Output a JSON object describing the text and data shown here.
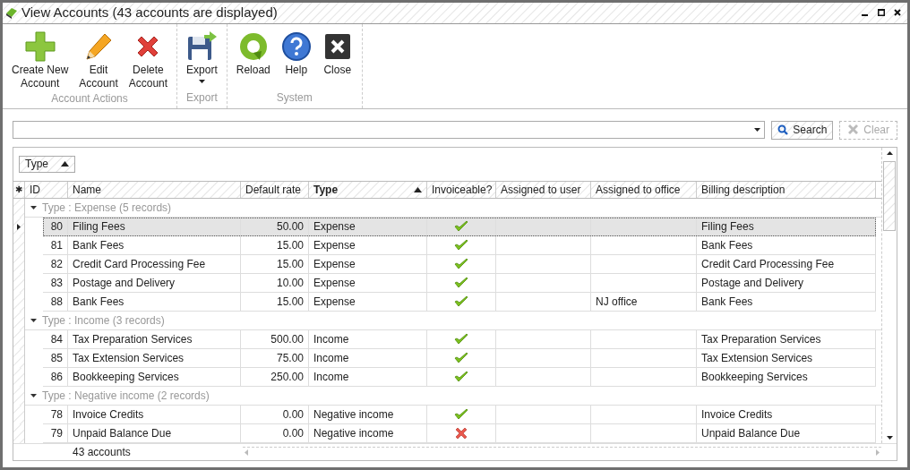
{
  "window": {
    "title": "View Accounts (43 accounts are displayed)"
  },
  "toolbar": {
    "groups": [
      {
        "label": "Account Actions",
        "buttons": [
          {
            "kind": "add",
            "lines": [
              "Create New",
              "Account"
            ]
          },
          {
            "kind": "edit",
            "lines": [
              "Edit",
              "Account"
            ]
          },
          {
            "kind": "delete",
            "lines": [
              "Delete",
              "Account"
            ]
          }
        ]
      },
      {
        "label": "Export",
        "buttons": [
          {
            "kind": "export",
            "lines": [
              "Export"
            ],
            "dropdown": true
          }
        ]
      },
      {
        "label": "System",
        "buttons": [
          {
            "kind": "reload",
            "lines": [
              "Reload"
            ]
          },
          {
            "kind": "help",
            "lines": [
              "Help"
            ]
          },
          {
            "kind": "close",
            "lines": [
              "Close"
            ]
          }
        ]
      }
    ]
  },
  "search": {
    "search_button": "Search",
    "clear_button": {
      "label": "Clear",
      "disabled": true
    }
  },
  "grid": {
    "group_by": "Type",
    "corner": "✱",
    "columns": [
      {
        "label": "ID",
        "sorted": false
      },
      {
        "label": "Name",
        "sorted": false
      },
      {
        "label": "Default rate",
        "sorted": false
      },
      {
        "label": "Type",
        "sorted": true
      },
      {
        "label": "Invoiceable?",
        "sorted": false
      },
      {
        "label": "Assigned to user",
        "sorted": false
      },
      {
        "label": "Assigned to office",
        "sorted": false
      },
      {
        "label": "Billing description",
        "sorted": false
      }
    ],
    "groups": [
      {
        "label": "Type : Expense (5 records)",
        "expanded": true,
        "rows": [
          {
            "id": "80",
            "name": "Filing Fees",
            "rate": "50.00",
            "type": "Expense",
            "invoiceable": true,
            "billing": "Filing Fees",
            "selected": true
          },
          {
            "id": "81",
            "name": "Bank Fees",
            "rate": "15.00",
            "type": "Expense",
            "invoiceable": true,
            "billing": "Bank Fees",
            "selected": false
          },
          {
            "id": "82",
            "name": "Credit Card Processing Fee",
            "rate": "15.00",
            "type": "Expense",
            "invoiceable": true,
            "billing": "Credit Card Processing Fee",
            "selected": false
          },
          {
            "id": "83",
            "name": "Postage and Delivery",
            "rate": "10.00",
            "type": "Expense",
            "invoiceable": true,
            "billing": "Postage and Delivery",
            "selected": false
          },
          {
            "id": "88",
            "name": "Bank Fees",
            "rate": "15.00",
            "type": "Expense",
            "invoiceable": true,
            "office": "NJ office",
            "billing": "Bank Fees",
            "selected": false
          }
        ]
      },
      {
        "label": "Type : Income (3 records)",
        "expanded": true,
        "rows": [
          {
            "id": "84",
            "name": "Tax Preparation Services",
            "rate": "500.00",
            "type": "Income",
            "invoiceable": true,
            "billing": "Tax Preparation Services",
            "selected": false
          },
          {
            "id": "85",
            "name": "Tax Extension Services",
            "rate": "75.00",
            "type": "Income",
            "invoiceable": true,
            "billing": "Tax Extension Services",
            "selected": false
          },
          {
            "id": "86",
            "name": "Bookkeeping Services",
            "rate": "250.00",
            "type": "Income",
            "invoiceable": true,
            "billing": "Bookkeeping Services",
            "selected": false
          }
        ]
      },
      {
        "label": "Type : Negative income (2 records)",
        "expanded": true,
        "rows": [
          {
            "id": "78",
            "name": "Invoice Credits",
            "rate": "0.00",
            "type": "Negative income",
            "invoiceable": true,
            "billing": "Invoice Credits",
            "selected": false
          },
          {
            "id": "79",
            "name": "Unpaid Balance Due",
            "rate": "0.00",
            "type": "Negative income",
            "invoiceable": false,
            "billing": "Unpaid Balance Due",
            "selected": false
          }
        ]
      }
    ],
    "footer": "43 accounts"
  }
}
